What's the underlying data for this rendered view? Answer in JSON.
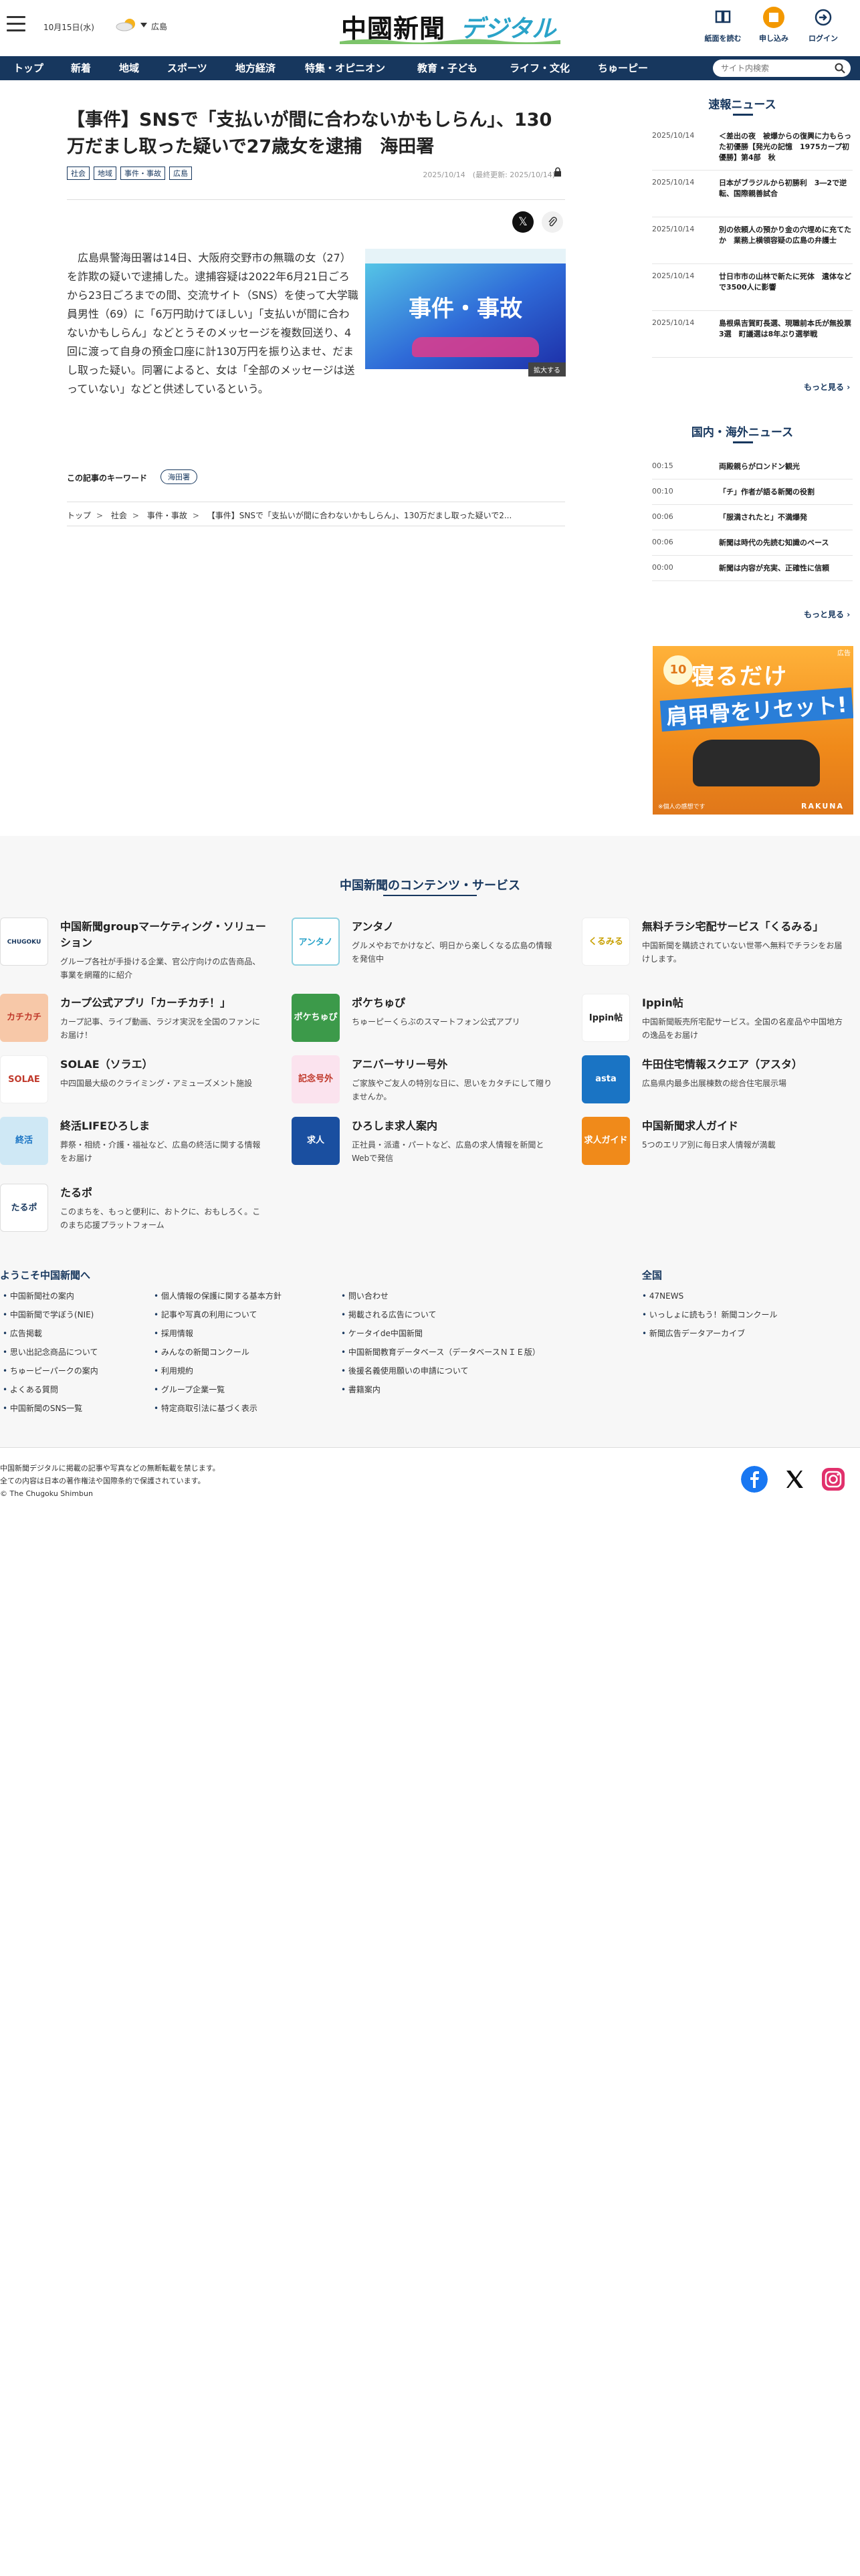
{
  "header": {
    "date": "10月15日(水)",
    "region": "広島",
    "logo_main": "中國新聞",
    "logo_sub": "デジタル",
    "buttons": [
      {
        "label": "紙面を読む",
        "icon": "book-icon"
      },
      {
        "label": "申し込み",
        "icon": "signup-icon"
      },
      {
        "label": "ログイン",
        "icon": "login-icon"
      }
    ]
  },
  "nav": {
    "items": [
      "トップ",
      "新着",
      "地域",
      "スポーツ",
      "地方経済",
      "特集・オピニオン",
      "教育・子ども",
      "ライフ・文化",
      "ちゅーピー"
    ],
    "search_placeholder": "サイト内検索"
  },
  "article": {
    "title": "【事件】SNSで「支払いが間に合わないかもしらん」、130万だまし取った疑いで27歳女を逮捕　海田署",
    "tags": [
      "社会",
      "地域",
      "事件・事故",
      "広島"
    ],
    "date": "2025/10/14　(最終更新: 2025/10/14)",
    "body": "広島県警海田署は14日、大阪府交野市の無職の女（27）を詐欺の疑いで逮捕した。逮捕容疑は2022年6月21日ごろから23日ごろまでの間、交流サイト（SNS）を使って大学職員男性（69）に「6万円助けてほしい」「支払いが間に合わないかもしらん」などとうそのメッセージを複数回送り、4回に渡って自身の預金口座に計130万円を振り込ませ、だまし取った疑い。同署によると、女は「全部のメッセージは送っていない」などと供述しているという。",
    "figure_text": "事件・事故",
    "figure_enlarge": "拡大する",
    "keyword_label": "この記事のキーワード",
    "keyword": "海田署",
    "breadcrumb": [
      "トップ",
      "社会",
      "事件・事故",
      "【事件】SNSで「支払いが間に合わないかもしらん」、130万だまし取った疑いで2..."
    ]
  },
  "sidebar": {
    "sokuho_title": "速報ニュース",
    "sokuho": [
      {
        "date": "2025/10/14",
        "title": "＜差出の夜　被爆からの復興に力もらった初優勝【発光の記憶　1975カープ初優勝】第4部　秋"
      },
      {
        "date": "2025/10/14",
        "title": "日本がブラジルから初勝利　3―2で逆転、国際親善試合"
      },
      {
        "date": "2025/10/14",
        "title": "別の依頼人の預かり金の穴埋めに充てたか　業務上横領容疑の広島の弁護士"
      },
      {
        "date": "2025/10/14",
        "title": "廿日市市の山林で新たに死体　遺体などで3500人に影響"
      },
      {
        "date": "2025/10/14",
        "title": "島根県吉賀町長選、現職前本氏が無投票3選　町議選は8年ぶり選挙戦"
      }
    ],
    "more1": "もっと見る",
    "kokunai_title": "国内・海外ニュース",
    "kokunai": [
      {
        "time": "00:15",
        "title": "両殿親らがロンドン観光"
      },
      {
        "time": "00:10",
        "title": "「チ」作者が語る新聞の役割"
      },
      {
        "time": "00:06",
        "title": "「服満されたと」不満爆発"
      },
      {
        "time": "00:06",
        "title": "新聞は時代の先読む知識のベース"
      },
      {
        "time": "00:00",
        "title": "新聞は内容が充実、正確性に信頼"
      }
    ],
    "more2": "もっと見る",
    "ad": {
      "label": "広告",
      "badge": "10",
      "copy1": "寝るだけ",
      "copy2": "肩甲骨をリセット!",
      "note": "※個人の感想です",
      "brand": "RAKUNA"
    }
  },
  "services": {
    "title": "中国新聞のコンテンツ・サービス",
    "items": [
      {
        "logo": "CHUGOKU",
        "name": "中国新聞groupマーケティング・ソリューション",
        "desc": "グループ各社が手掛ける企業、官公庁向けの広告商品、事業を網羅的に紹介"
      },
      {
        "logo": "アンタノ",
        "name": "アンタノ",
        "desc": "グルメやおでかけなど、明日から楽しくなる広島の情報を発信中"
      },
      {
        "logo": "くるみる",
        "name": "無料チラシ宅配サービス「くるみる」",
        "desc": "中国新聞を購読されていない世帯へ無料でチラシをお届けします。"
      },
      {
        "logo": "カチカチ",
        "name": "カープ公式アプリ「カーチカチ！」",
        "desc": "カープ記事、ライブ動画、ラジオ実況を全国のファンにお届け！"
      },
      {
        "logo": "ポケちゅぴ",
        "name": "ポケちゅぴ",
        "desc": "ちゅーピーくらぶのスマートフォン公式アプリ"
      },
      {
        "logo": "Ippin帖",
        "name": "Ippin帖",
        "desc": "中国新聞販売所宅配サービス。全国の名産品や中国地方の逸品をお届け"
      },
      {
        "logo": "SOLAE",
        "name": "SOLAE（ソラエ）",
        "desc": "中四国最大級のクライミング・アミューズメント施設"
      },
      {
        "logo": "記念号外",
        "name": "アニバーサリー号外",
        "desc": "ご家族やご友人の特別な日に、思いをカタチにして贈りませんか。"
      },
      {
        "logo": "asta",
        "name": "牛田住宅情報スクエア（アスタ）",
        "desc": "広島県内最多出展棟数の総合住宅展示場"
      },
      {
        "logo": "終活",
        "name": "終活LIFEひろしま",
        "desc": "葬祭・相続・介護・福祉など、広島の終活に関する情報をお届け"
      },
      {
        "logo": "求人",
        "name": "ひろしま求人案内",
        "desc": "正社員・派遣・パートなど、広島の求人情報を新聞とWebで発信"
      },
      {
        "logo": "求人ガイド",
        "name": "中国新聞求人ガイド",
        "desc": "5つのエリア別に毎日求人情報が満載"
      },
      {
        "logo": "たるポ",
        "name": "たるポ",
        "desc": "このまちを、もっと便利に、おトクに、おもしろく。このまち応援プラットフォーム"
      }
    ]
  },
  "footer": {
    "welcome_title": "ようこそ中国新聞へ",
    "col1": [
      "中国新聞社の案内",
      "中国新聞で学ぼう(NIE)",
      "広告掲載",
      "思い出記念商品について",
      "ちゅーピーパークの案内",
      "よくある質問",
      "中国新聞のSNS一覧"
    ],
    "col2": [
      "個人情報の保護に関する基本方針",
      "記事や写真の利用について",
      "採用情報",
      "みんなの新聞コンクール",
      "利用規約",
      "グループ企業一覧",
      "特定商取引法に基づく表示"
    ],
    "col3": [
      "問い合わせ",
      "掲載される広告について",
      "ケータイde中国新聞",
      "中国新聞教育データベース（データベースＮＩＥ版）",
      "後援名義使用願いの申請について",
      "書籍案内"
    ],
    "zenkoku_title": "全国",
    "col4": [
      "47NEWS",
      "いっしょに読もう！新聞コンクール",
      "新聞広告データアーカイブ"
    ],
    "copyright": [
      "中国新聞デジタルに掲載の記事や写真などの無断転載を禁じます。",
      "全ての内容は日本の著作権法や国際条約で保護されています。",
      "© The Chugoku Shimbun"
    ],
    "social": [
      "facebook-icon",
      "x-icon",
      "instagram-icon"
    ]
  },
  "colors": {
    "brand": "#17375e",
    "accent": "#2aa3c9",
    "facebook": "#1877f2",
    "instagram": "#e1306c"
  }
}
